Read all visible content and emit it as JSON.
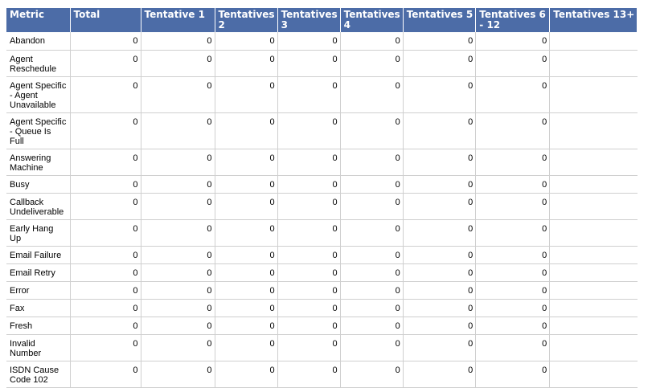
{
  "headers": [
    "Metric",
    "Total",
    "Tentative 1",
    "Tentatives 2",
    "Tentatives 3",
    "Tentatives 4",
    "Tentatives 5",
    "Tentatives 6 - 12",
    "Tentatives 13+"
  ],
  "rows": [
    {
      "metric": "Abandon",
      "values": [
        "0",
        "0",
        "0",
        "0",
        "0",
        "0",
        "0",
        ""
      ]
    },
    {
      "metric": "Agent Reschedule",
      "values": [
        "0",
        "0",
        "0",
        "0",
        "0",
        "0",
        "0",
        ""
      ]
    },
    {
      "metric": "Agent Specific - Agent Unavailable",
      "values": [
        "0",
        "0",
        "0",
        "0",
        "0",
        "0",
        "0",
        ""
      ]
    },
    {
      "metric": "Agent Specific - Queue Is Full",
      "values": [
        "0",
        "0",
        "0",
        "0",
        "0",
        "0",
        "0",
        ""
      ]
    },
    {
      "metric": "Answering Machine",
      "values": [
        "0",
        "0",
        "0",
        "0",
        "0",
        "0",
        "0",
        ""
      ]
    },
    {
      "metric": "Busy",
      "values": [
        "0",
        "0",
        "0",
        "0",
        "0",
        "0",
        "0",
        ""
      ]
    },
    {
      "metric": "Callback Undeliverable",
      "values": [
        "0",
        "0",
        "0",
        "0",
        "0",
        "0",
        "0",
        ""
      ]
    },
    {
      "metric": "Early Hang Up",
      "values": [
        "0",
        "0",
        "0",
        "0",
        "0",
        "0",
        "0",
        ""
      ]
    },
    {
      "metric": "Email Failure",
      "values": [
        "0",
        "0",
        "0",
        "0",
        "0",
        "0",
        "0",
        ""
      ]
    },
    {
      "metric": "Email Retry",
      "values": [
        "0",
        "0",
        "0",
        "0",
        "0",
        "0",
        "0",
        ""
      ]
    },
    {
      "metric": "Error",
      "values": [
        "0",
        "0",
        "0",
        "0",
        "0",
        "0",
        "0",
        ""
      ]
    },
    {
      "metric": "Fax",
      "values": [
        "0",
        "0",
        "0",
        "0",
        "0",
        "0",
        "0",
        ""
      ]
    },
    {
      "metric": "Fresh",
      "values": [
        "0",
        "0",
        "0",
        "0",
        "0",
        "0",
        "0",
        ""
      ]
    },
    {
      "metric": "Invalid Number",
      "values": [
        "0",
        "0",
        "0",
        "0",
        "0",
        "0",
        "0",
        ""
      ]
    },
    {
      "metric": "ISDN Cause Code 102",
      "values": [
        "0",
        "0",
        "0",
        "0",
        "0",
        "0",
        "0",
        ""
      ]
    }
  ],
  "colors": {
    "header_bg": "#4c6ca7",
    "header_text": "#ffffff",
    "grid_line": "#cfcfcf"
  }
}
